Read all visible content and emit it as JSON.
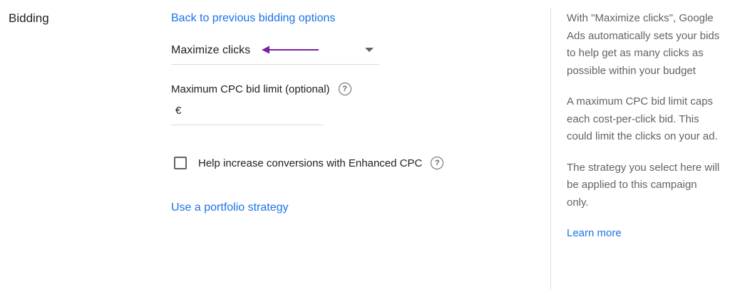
{
  "section": {
    "label": "Bidding"
  },
  "bidding": {
    "back_link": "Back to previous bidding options",
    "strategy_value": "Maximize clicks",
    "cpc_label": "Maximum CPC bid limit (optional)",
    "currency_symbol": "€",
    "cpc_value": "",
    "enhanced_cpc_label": "Help increase conversions with Enhanced CPC",
    "enhanced_cpc_checked": false,
    "portfolio_link": "Use a portfolio strategy"
  },
  "help": {
    "icon_glyph": "?"
  },
  "side_panel": {
    "paragraphs": [
      "With \"Maximize clicks\", Google Ads automatically sets your bids to help get as many clicks as possible within your budget",
      "A maximum CPC bid limit caps each cost-per-click bid. This could limit the clicks on your ad.",
      "The strategy you select here will be applied to this campaign only."
    ],
    "learn_more": "Learn more"
  },
  "colors": {
    "link": "#1a73e8",
    "annotation_arrow": "#7b1fa2",
    "secondary_text": "#5f6368",
    "divider": "#dadce0"
  },
  "icons": [
    "help-icon",
    "dropdown-arrow-icon",
    "annotation-arrow-icon",
    "checkbox-icon"
  ]
}
